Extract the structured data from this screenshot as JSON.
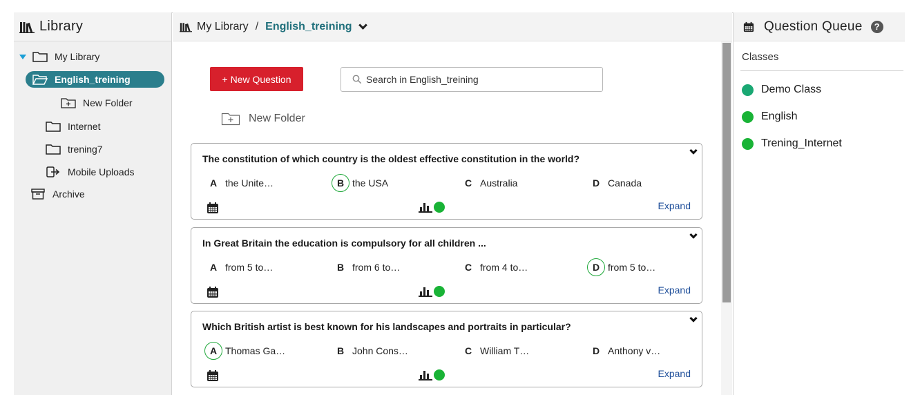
{
  "sidebar": {
    "title": "Library",
    "items": [
      {
        "label": "My Library"
      },
      {
        "label": "English_treining"
      },
      {
        "label": "New Folder"
      },
      {
        "label": "Internet"
      },
      {
        "label": "trening7"
      },
      {
        "label": "Mobile Uploads"
      },
      {
        "label": "Archive"
      }
    ]
  },
  "header": {
    "crumb_root": "My Library",
    "crumb_separator": "/",
    "crumb_current": "English_treining"
  },
  "toolbar": {
    "new_question_label": "+ New Question",
    "search_placeholder": "Search in English_treining",
    "new_folder_label": "New Folder"
  },
  "questions": [
    {
      "title": "The constitution of which country is the oldest effective constitution in the world?",
      "answers": [
        {
          "letter": "A",
          "text": "the Unite…"
        },
        {
          "letter": "B",
          "text": "the USA",
          "correct": true
        },
        {
          "letter": "C",
          "text": "Australia"
        },
        {
          "letter": "D",
          "text": "Canada"
        }
      ],
      "expand_label": "Expand"
    },
    {
      "title": "In Great Britain the education is compulsory for all children ...",
      "answers": [
        {
          "letter": "A",
          "text": "from 5 to…"
        },
        {
          "letter": "B",
          "text": "from 6 to…"
        },
        {
          "letter": "C",
          "text": "from 4 to…"
        },
        {
          "letter": "D",
          "text": "from 5 to…",
          "correct": true
        }
      ],
      "expand_label": "Expand"
    },
    {
      "title": "Which British artist is best known for his landscapes and portraits in particular?",
      "answers": [
        {
          "letter": "A",
          "text": "Thomas Ga…",
          "correct": true
        },
        {
          "letter": "B",
          "text": "John Cons…"
        },
        {
          "letter": "C",
          "text": "William T…"
        },
        {
          "letter": "D",
          "text": "Anthony v…"
        }
      ],
      "expand_label": "Expand"
    }
  ],
  "queue": {
    "title": "Question Queue",
    "help_icon": "?",
    "classes_label": "Classes",
    "classes": [
      {
        "name": "Demo Class",
        "color": "#1aa873"
      },
      {
        "name": "English",
        "color": "#19b336"
      },
      {
        "name": "Trening_Internet",
        "color": "#19b336"
      }
    ]
  },
  "colors": {
    "accent": "#2b7e8c",
    "primary_button": "#d7202c",
    "correct": "#1fa83a",
    "link": "#1f4f9a"
  }
}
